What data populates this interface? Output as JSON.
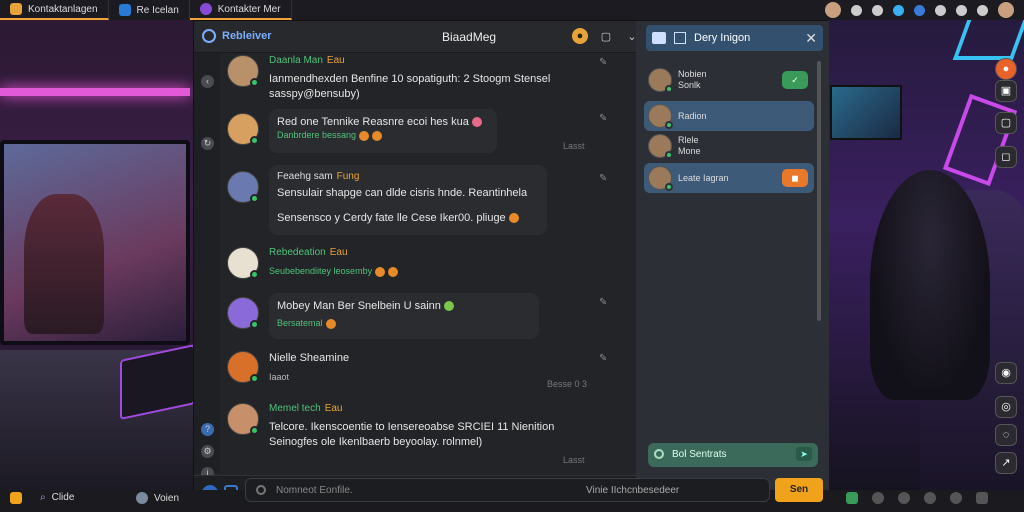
{
  "taskbar": {
    "tabs": [
      {
        "label": "Kontaktanlagen",
        "icon": "folder-icon"
      },
      {
        "label": "Re Icelan",
        "icon": "browser-icon"
      },
      {
        "label": "Kontakter Mer",
        "icon": "chat-app-icon"
      }
    ]
  },
  "chat": {
    "brand": "Rebleiver",
    "title": "BiaadMeg",
    "messages": [
      {
        "name": "Daanla Man",
        "tag": "Eau",
        "text": "Ianmendhexden Benfine 10 sopatiguth: 2 Stoogm Stensel",
        "text2": "sasspy@bensuby)",
        "edit": "✎"
      },
      {
        "name": "",
        "tag": "",
        "text": "Red one Tennike Reasnre ecoi hes kua",
        "sub": "Danbrdere bessang",
        "time": "Lasst"
      },
      {
        "name": "Feaehg sam",
        "tag": "Fung",
        "text": "Sensulair shapge can dlde cisris hnde. Reantinhela",
        "text2": "Sensensco y Cerdy fate lle Cese Iker00. pliuge"
      },
      {
        "name": "Rebedeation",
        "tag": "Eau",
        "text": "",
        "sub": "Seubebendiitey leosemby"
      },
      {
        "name": "Mobey Man",
        "tag": "",
        "text": "Mobey Man Ber Snelbein U sainn",
        "sub": "Bersatemal"
      },
      {
        "name": "Nielle Sheamine",
        "tag": "",
        "text": "",
        "sub": "Iaaot",
        "time": "Besse 0 3"
      },
      {
        "name": "Memel tech",
        "tag": "Eau",
        "text": "Telcore. Ikenscoentie to Iensereoabse SRCIEI 11 Nienition",
        "text2": "Seinogfes ole Ikenlbaerb beyoolay. rolnmel)",
        "time": "Lasst"
      }
    ],
    "input_placeholder": "Nomneot Eonfile.",
    "input_hint": "Vinie IIchcnbesedeer",
    "send_label": "Sen"
  },
  "right_panel": {
    "title": "Dery Inigon",
    "contacts": [
      {
        "name": "Nobien",
        "sub": "Sonlk",
        "badge": "✓",
        "badge_color": "#3a9a5a"
      },
      {
        "name": "Radion",
        "sub": "",
        "badge": "",
        "badge_color": ""
      },
      {
        "name": "Rlele",
        "sub": "Mone",
        "badge": "",
        "badge_color": ""
      },
      {
        "name": "Leate Iagran",
        "sub": "",
        "badge": "◼",
        "badge_color": "#e8782a"
      }
    ],
    "input_label": "Bol Sentrats"
  },
  "bottom": {
    "start_label": "Clide",
    "app_label": "Voien"
  },
  "colors": {
    "accent": "#f0a21a",
    "online": "#39c46a",
    "brand": "#7ab0ff"
  }
}
